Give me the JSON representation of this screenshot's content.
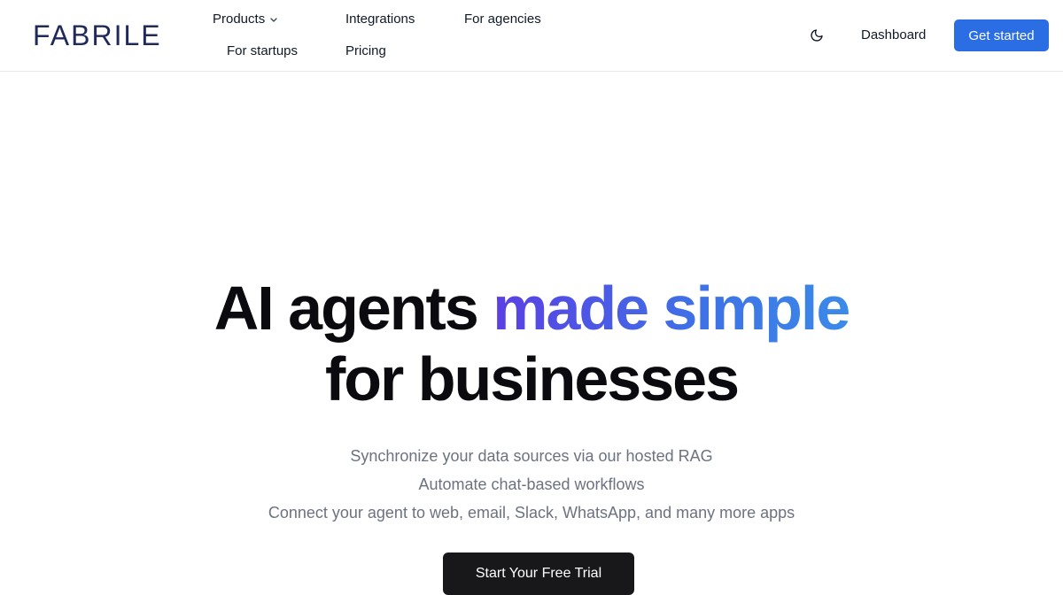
{
  "header": {
    "logo_text": "FABRILE",
    "nav": {
      "products": "Products",
      "integrations": "Integrations",
      "for_agencies": "For agencies",
      "for_startups": "For startups",
      "pricing": "Pricing"
    },
    "theme_toggle_icon": "moon-icon",
    "dashboard_label": "Dashboard",
    "get_started_label": "Get started"
  },
  "hero": {
    "title_part1": "AI agents ",
    "title_highlight": "made simple",
    "title_line2": "for businesses",
    "subtitles": [
      "Synchronize your data sources via our hosted RAG",
      "Automate chat-based workflows",
      "Connect your agent to web, email, Slack, WhatsApp, and many more apps"
    ],
    "cta_label": "Start Your Free Trial"
  },
  "colors": {
    "brand_blue": "#2b6de3",
    "logo_navy": "#1f2a5a",
    "gradient_start": "#5b3fe4",
    "gradient_end": "#3b8ae8",
    "cta_dark": "#18181b"
  }
}
